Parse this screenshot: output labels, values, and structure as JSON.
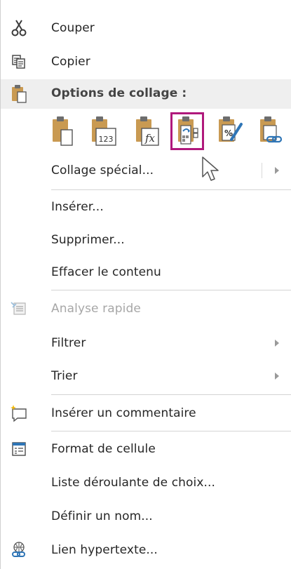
{
  "menu": {
    "cut": {
      "label": "Couper",
      "icon": "scissors-icon"
    },
    "copy": {
      "label": "Copier",
      "icon": "copy-icon"
    },
    "paste_options": {
      "label": "Options de collage :",
      "icon": "clipboard-paste-icon"
    },
    "paste_buttons": [
      {
        "name": "paste-button",
        "icon": "clipboard-icon"
      },
      {
        "name": "paste-values-button",
        "icon": "clipboard-values-icon",
        "text": "123"
      },
      {
        "name": "paste-formulas-button",
        "icon": "clipboard-formulas-icon",
        "text": "fx"
      },
      {
        "name": "paste-transpose-button",
        "icon": "clipboard-transpose-icon",
        "selected": true
      },
      {
        "name": "paste-formatting-button",
        "icon": "clipboard-formatting-icon",
        "text": "%"
      },
      {
        "name": "paste-link-button",
        "icon": "clipboard-link-icon"
      }
    ],
    "paste_special": {
      "label": "Collage spécial..."
    },
    "insert": {
      "label": "Insérer..."
    },
    "delete": {
      "label": "Supprimer..."
    },
    "clear_contents": {
      "label": "Effacer le contenu"
    },
    "quick_analysis": {
      "label": "Analyse rapide",
      "icon": "quick-analysis-icon",
      "disabled": true
    },
    "filter": {
      "label": "Filtrer"
    },
    "sort": {
      "label": "Trier"
    },
    "insert_comment": {
      "label": "Insérer un commentaire",
      "icon": "new-comment-icon"
    },
    "format_cells": {
      "label": "Format de cellule",
      "icon": "format-cells-icon"
    },
    "dropdown_list": {
      "label": "Liste déroulante de choix..."
    },
    "define_name": {
      "label": "Définir un nom..."
    },
    "hyperlink": {
      "label": "Lien hypertexte...",
      "icon": "hyperlink-icon"
    }
  },
  "colors": {
    "selected_outline": "#b0197c",
    "clipboard_tan": "#c99a52",
    "accent_blue": "#2e75b6"
  }
}
